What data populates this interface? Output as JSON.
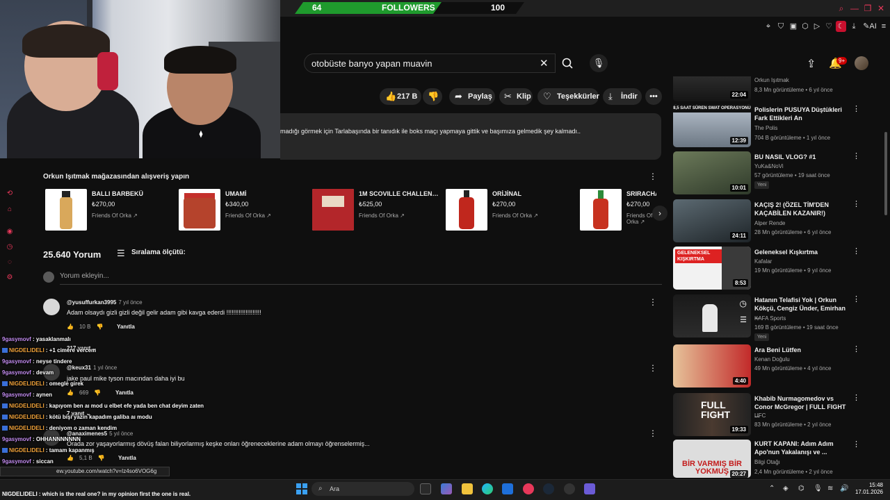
{
  "stream": {
    "followers_current": "64",
    "followers_label": "FOLLOWERS",
    "followers_goal": "100",
    "followers_progress": 0.64
  },
  "search": {
    "query": "otobüste banyo yapan muavin"
  },
  "header": {
    "notifications_badge": "9+"
  },
  "actions": {
    "like_count": "217 B",
    "share": "Paylaş",
    "clip": "Klip",
    "thanks": "Teşekkürler",
    "download": "İndir"
  },
  "description": {
    "text": "madığı görmek için Tarlabaşında bir tanıdık ile boks maçı yapmaya gittik ve başımıza gelmedik şey kalmadı.."
  },
  "shop": {
    "title": "Orkun Işıtmak mağazasından alışveriş yapın",
    "products": [
      {
        "name": "BALLI BARBEKÜ",
        "price": "₺270,00",
        "seller": "Friends Of Orka"
      },
      {
        "name": "UMAMİ",
        "price": "₺340,00",
        "seller": "Friends Of Orka"
      },
      {
        "name": "1M SCOVILLE CHALLENG...",
        "price": "₺525,00",
        "seller": "Friends Of Orka"
      },
      {
        "name": "ORİJİNAL",
        "price": "₺270,00",
        "seller": "Friends Of Orka"
      },
      {
        "name": "SRIRACHA",
        "price": "₺270,00",
        "seller": "Friends Of Orka"
      }
    ]
  },
  "comments_section": {
    "count": "25.640 Yorum",
    "sort_label": "Sıralama ölçütü:",
    "add_placeholder": "Yorum ekleyin...",
    "reply_label": "Yanıtla",
    "comments": [
      {
        "author": "@yusuffurkan3995",
        "time": "7 yıl önce",
        "text": "Adam olsaydı gizli gizli değil gelir adam gibi kavga ederdi !!!!!!!!!!!!!!!!!!!!",
        "likes": "10 B",
        "replies": "217 yanıt"
      },
      {
        "author": "@keux31",
        "time": "1 yıl önce",
        "text": "jake paul mike tyson macından daha iyi bu",
        "likes": "669",
        "replies": "7 yanıt"
      },
      {
        "author": "@anaximenes5",
        "time": "5 yıl önce",
        "text": "Orada zor yaşayorlarmış dövüş falan biliyorlarmış keşke onları öğreneceklerine adam olmayı öğrenselermiş...",
        "likes": "5,1 B",
        "replies": ""
      }
    ]
  },
  "chat": [
    {
      "user": "9gasymovf",
      "msg": "yasaklanmalı",
      "badge": false,
      "color": "u1"
    },
    {
      "user": "NIGDELIDELI",
      "msg": "+1 cimere vercem",
      "badge": true,
      "color": "u2"
    },
    {
      "user": "9gasymovf",
      "msg": "neyse tindere",
      "badge": false,
      "color": "u1"
    },
    {
      "user": "9gasymovf",
      "msg": "devam",
      "badge": false,
      "color": "u1"
    },
    {
      "user": "NIGDELIDELI",
      "msg": "omegle girek",
      "badge": true,
      "color": "u2"
    },
    {
      "user": "9gasymovf",
      "msg": "aynen",
      "badge": false,
      "color": "u1"
    },
    {
      "user": "NIGDELIDELI",
      "msg": "kapıyom ben aı mod u elbet efe yada ben chat deyim zaten",
      "badge": true,
      "color": "u2"
    },
    {
      "user": "NIGDELIDELI",
      "msg": "kötü bişi yazın kapadım galiba aı modu",
      "badge": true,
      "color": "u2"
    },
    {
      "user": "NIGDELIDELI",
      "msg": "deniyom o zaman kendim",
      "badge": true,
      "color": "u2"
    },
    {
      "user": "9gasymovf",
      "msg": "OHHANNNNNNN",
      "badge": false,
      "color": "u1"
    },
    {
      "user": "NIGDELIDELI",
      "msg": "tamam kapanmış",
      "badge": true,
      "color": "u2"
    },
    {
      "user": "9gasymovf",
      "msg": "siccan",
      "badge": false,
      "color": "u1"
    },
    {
      "user": "9gasymovf",
      "msg": "altına",
      "badge": false,
      "color": "u1"
    }
  ],
  "bottom_chat": "NIGDELIDELI : which is the real one? in my opinion first the one is real.",
  "url_tooltip": "ew.youtube.com/watch?v=Iz4so6VOG6g",
  "sidebar": [
    {
      "title": "",
      "channel": "Orkun Işıtmak",
      "meta": "8,3 Mn görüntüleme • 6 yıl önce",
      "duration": "22:04",
      "new": "",
      "thumb_caption": "8,5 SAAT SÜREN SWAT OPERASYONU"
    },
    {
      "title": "Polislerin PUSUYA Düştükleri Fark Ettikleri An",
      "channel": "The Polis",
      "meta": "704 B görüntüleme • 1 yıl önce",
      "duration": "12:39",
      "new": "",
      "thumb_caption": ""
    },
    {
      "title": "BU NASIL VLOG? #1",
      "channel": "YuKa&NoVi",
      "meta": "57 görüntüleme • 19 saat önce",
      "duration": "10:01",
      "new": "Yeni",
      "thumb_caption": ""
    },
    {
      "title": "KAÇIŞ 2! (ÖZEL TİM'DEN KAÇABİLEN KAZANIR!)",
      "channel": "Alper Rende",
      "meta": "28 Mn görüntüleme • 6 yıl önce",
      "duration": "24:11",
      "new": "",
      "thumb_caption": ""
    },
    {
      "title": "Geleneksel Kışkırtma",
      "channel": "Kafalar",
      "meta": "19 Mn görüntüleme • 9 yıl önce",
      "duration": "8:53",
      "new": "",
      "thumb_caption": "GELENEKSEL KIŞKIRTMA"
    },
    {
      "title": "Hatanın Telafisi Yok | Orkun Kökçü, Cengiz Ünder, Emirhan ...",
      "channel": "KAFA Sports",
      "meta": "169 B görüntüleme • 19 saat önce",
      "duration": "",
      "new": "Yeni",
      "thumb_caption": ""
    },
    {
      "title": "Ara Beni Lütfen",
      "channel": "Kenan Doğulu",
      "meta": "49 Mn görüntüleme • 4 yıl önce",
      "duration": "4:40",
      "new": "",
      "thumb_caption": ""
    },
    {
      "title": "Khabib Nurmagomedov vs Conor McGregor | FULL FIGHT ...",
      "channel": "UFC",
      "meta": "83 Mn görüntüleme • 2 yıl önce",
      "duration": "19:33",
      "new": "",
      "thumb_caption": "FULL FIGHT"
    },
    {
      "title": "KURT KAPANI: Adım Adım Apo'nun Yakalanışı ve ...",
      "channel": "Bilgi Otağı",
      "meta": "2,4 Mn görüntüleme • 2 yıl önce",
      "duration": "20:27",
      "new": "",
      "thumb_caption": "BİR VARMIŞ BİR YOKMUŞ"
    }
  ],
  "taskbar": {
    "search_placeholder": "Ara",
    "time": "15:48",
    "date": "17.01.2026"
  },
  "colors": {
    "background": "#0f0f0f",
    "accent_red": "#cc0000",
    "stream_green": "#1f9a2d",
    "chat_purple": "#c48df2",
    "chat_orange": "#f2a33a"
  }
}
